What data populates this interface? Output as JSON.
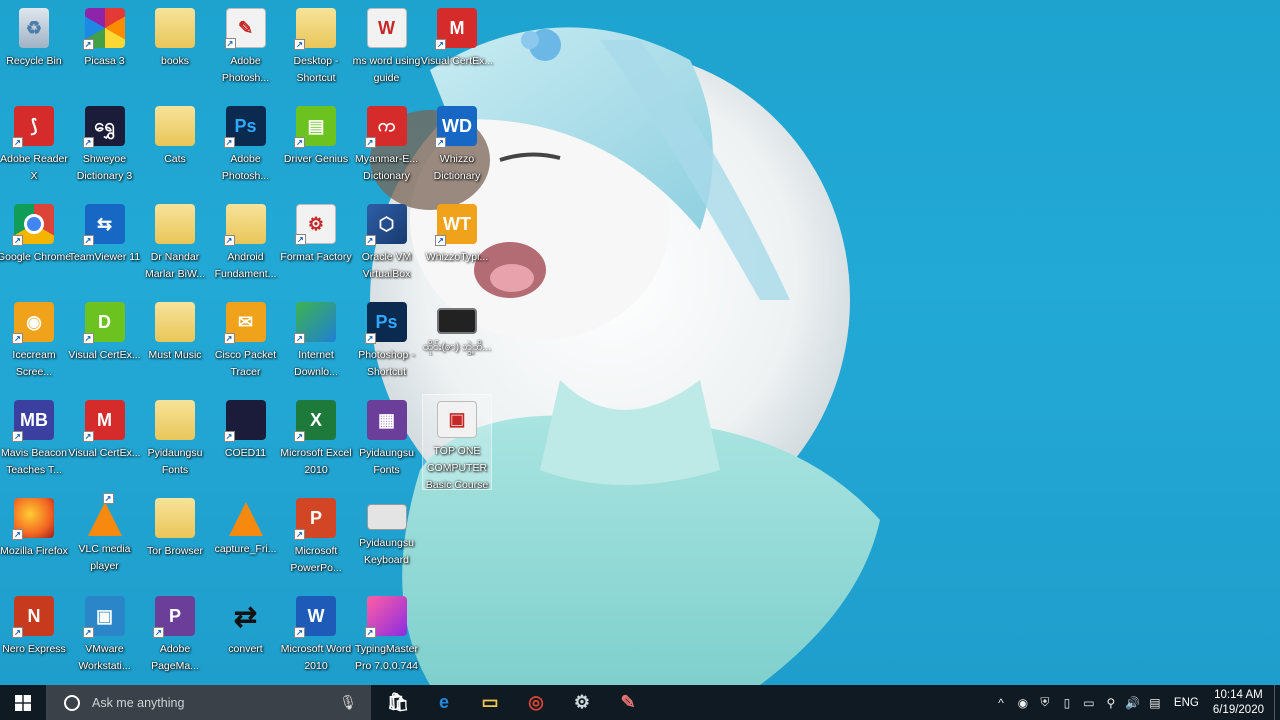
{
  "desktop": {
    "icons": [
      {
        "label": "Recycle Bin",
        "icon": "recycle-bin-icon",
        "glyph": "♻",
        "style": "g-bin",
        "col": 0,
        "row": 0,
        "shortcut": false
      },
      {
        "label": "Adobe Reader X",
        "icon": "adobe-reader-icon",
        "glyph": "⟆",
        "style": "g-red",
        "col": 0,
        "row": 1,
        "shortcut": true
      },
      {
        "label": "Google Chrome",
        "icon": "chrome-icon",
        "glyph": "",
        "style": "g-chrome",
        "col": 0,
        "row": 2,
        "shortcut": true
      },
      {
        "label": "Icecream Scree...",
        "icon": "icecream-recorder-icon",
        "glyph": "◉",
        "style": "g-orange",
        "col": 0,
        "row": 3,
        "shortcut": true
      },
      {
        "label": "Mavis Beacon Teaches T...",
        "icon": "mavis-beacon-icon",
        "glyph": "MB",
        "style": "g-purple",
        "col": 0,
        "row": 4,
        "shortcut": true
      },
      {
        "label": "Mozilla Firefox",
        "icon": "firefox-icon",
        "glyph": "",
        "style": "g-ff",
        "col": 0,
        "row": 5,
        "shortcut": true
      },
      {
        "label": "Nero Express",
        "icon": "nero-express-icon",
        "glyph": "N",
        "style": "g-nero",
        "col": 0,
        "row": 6,
        "shortcut": true
      },
      {
        "label": "Picasa 3",
        "icon": "picasa-icon",
        "glyph": "",
        "style": "g-picasa",
        "col": 1,
        "row": 0,
        "shortcut": true
      },
      {
        "label": "Shweyoe Dictionary 3",
        "icon": "shweyoe-dictionary-icon",
        "glyph": "ရွှေ",
        "style": "g-dark",
        "col": 1,
        "row": 1,
        "shortcut": true
      },
      {
        "label": "TeamViewer 11",
        "icon": "teamviewer-icon",
        "glyph": "⇆",
        "style": "g-blue",
        "col": 1,
        "row": 2,
        "shortcut": true
      },
      {
        "label": "Visual CertEx...",
        "icon": "visual-certexam-designer-icon",
        "glyph": "D",
        "style": "g-green",
        "col": 1,
        "row": 3,
        "shortcut": true
      },
      {
        "label": "Visual CertEx...",
        "icon": "visual-certexam-manager-icon",
        "glyph": "M",
        "style": "g-red",
        "col": 1,
        "row": 4,
        "shortcut": true
      },
      {
        "label": "VLC media player",
        "icon": "vlc-icon",
        "glyph": "",
        "style": "g-vlc",
        "col": 1,
        "row": 5,
        "shortcut": true
      },
      {
        "label": "VMware Workstati...",
        "icon": "vmware-icon",
        "glyph": "▣",
        "style": "g-vm",
        "col": 1,
        "row": 6,
        "shortcut": true
      },
      {
        "label": "books",
        "icon": "folder-icon",
        "glyph": "",
        "style": "g-folder",
        "col": 2,
        "row": 0,
        "shortcut": false
      },
      {
        "label": "Cats",
        "icon": "folder-icon",
        "glyph": "",
        "style": "g-folder",
        "col": 2,
        "row": 1,
        "shortcut": false
      },
      {
        "label": "Dr Nandar Marlar BiW...",
        "icon": "folder-icon",
        "glyph": "",
        "style": "g-folder",
        "col": 2,
        "row": 2,
        "shortcut": false
      },
      {
        "label": "Must Music",
        "icon": "folder-icon",
        "glyph": "",
        "style": "g-folder",
        "col": 2,
        "row": 3,
        "shortcut": false
      },
      {
        "label": "Pyidaungsu Fonts",
        "icon": "folder-icon",
        "glyph": "",
        "style": "g-folder",
        "col": 2,
        "row": 4,
        "shortcut": false
      },
      {
        "label": "Tor Browser",
        "icon": "folder-icon",
        "glyph": "",
        "style": "g-folder",
        "col": 2,
        "row": 5,
        "shortcut": false
      },
      {
        "label": "Adobe PageMa...",
        "icon": "adobe-pagemaker-icon",
        "glyph": "P",
        "style": "g-pm",
        "col": 2,
        "row": 6,
        "shortcut": true
      },
      {
        "label": "Adobe Photosh...",
        "icon": "photoshop-feather-icon",
        "glyph": "✎",
        "style": "g-white",
        "col": 3,
        "row": 0,
        "shortcut": true
      },
      {
        "label": "Adobe Photosh...",
        "icon": "photoshop-icon",
        "glyph": "Ps",
        "style": "g-ps",
        "col": 3,
        "row": 1,
        "shortcut": true
      },
      {
        "label": "Android Fundament...",
        "icon": "folder-icon",
        "glyph": "",
        "style": "g-folder",
        "col": 3,
        "row": 2,
        "shortcut": true
      },
      {
        "label": "Cisco Packet Tracer",
        "icon": "cisco-packet-tracer-icon",
        "glyph": "✉",
        "style": "g-orange",
        "col": 3,
        "row": 3,
        "shortcut": true
      },
      {
        "label": "COED11",
        "icon": "coed11-icon",
        "glyph": "",
        "style": "g-dark",
        "col": 3,
        "row": 4,
        "shortcut": true
      },
      {
        "label": "capture_Fri...",
        "icon": "vlc-icon",
        "glyph": "",
        "style": "g-vlc",
        "col": 3,
        "row": 5,
        "shortcut": false
      },
      {
        "label": "convert",
        "icon": "convert-arrows-icon",
        "glyph": "⇄",
        "style": "g-convert",
        "col": 3,
        "row": 6,
        "shortcut": false
      },
      {
        "label": "Desktop - Shortcut",
        "icon": "desktop-folder-icon",
        "glyph": "",
        "style": "g-folder",
        "col": 4,
        "row": 0,
        "shortcut": true
      },
      {
        "label": "Driver Genius",
        "icon": "driver-genius-icon",
        "glyph": "▤",
        "style": "g-green",
        "col": 4,
        "row": 1,
        "shortcut": true
      },
      {
        "label": "Format Factory",
        "icon": "format-factory-icon",
        "glyph": "⚙",
        "style": "g-white",
        "col": 4,
        "row": 2,
        "shortcut": true
      },
      {
        "label": "Internet Downlo...",
        "icon": "internet-download-manager-icon",
        "glyph": "",
        "style": "g-ie",
        "col": 4,
        "row": 3,
        "shortcut": true
      },
      {
        "label": "Microsoft Excel 2010",
        "icon": "excel-icon",
        "glyph": "X",
        "style": "g-excel",
        "col": 4,
        "row": 4,
        "shortcut": true
      },
      {
        "label": "Microsoft PowerPo...",
        "icon": "powerpoint-icon",
        "glyph": "P",
        "style": "g-ppt",
        "col": 4,
        "row": 5,
        "shortcut": true
      },
      {
        "label": "Microsoft Word 2010",
        "icon": "word-icon",
        "glyph": "W",
        "style": "g-word",
        "col": 4,
        "row": 6,
        "shortcut": true
      },
      {
        "label": "ms word using guide",
        "icon": "word-document-icon",
        "glyph": "W",
        "style": "g-white",
        "col": 5,
        "row": 0,
        "shortcut": false
      },
      {
        "label": "Myanmar-E... Dictionary",
        "icon": "myanmar-dictionary-icon",
        "glyph": "က",
        "style": "g-red",
        "col": 5,
        "row": 1,
        "shortcut": true
      },
      {
        "label": "Oracle VM VirtualBox",
        "icon": "virtualbox-icon",
        "glyph": "⬡",
        "style": "g-vbox",
        "col": 5,
        "row": 2,
        "shortcut": true
      },
      {
        "label": "Photoshop - Shortcut",
        "icon": "photoshop-icon",
        "glyph": "Ps",
        "style": "g-ps",
        "col": 5,
        "row": 3,
        "shortcut": true
      },
      {
        "label": "Pyidaungsu Fonts",
        "icon": "winrar-icon",
        "glyph": "▦",
        "style": "g-pm",
        "col": 5,
        "row": 4,
        "shortcut": false
      },
      {
        "label": "Pyidaungsu Keyboard",
        "icon": "keyboard-image-icon",
        "glyph": "",
        "style": "g-kbd",
        "col": 5,
        "row": 5,
        "shortcut": false
      },
      {
        "label": "TypingMaster Pro 7.0.0.744",
        "icon": "typingmaster-icon",
        "glyph": "",
        "style": "g-typing",
        "col": 5,
        "row": 6,
        "shortcut": true
      },
      {
        "label": "Visual CertEx...",
        "icon": "visual-certexam-manager-icon",
        "glyph": "M",
        "style": "g-red",
        "col": 6,
        "row": 0,
        "shortcut": true
      },
      {
        "label": "Whizzo Dictionary",
        "icon": "whizzo-dictionary-icon",
        "glyph": "WD",
        "style": "g-blue",
        "col": 6,
        "row": 1,
        "shortcut": true
      },
      {
        "label": "WhizzoTypi...",
        "icon": "whizzo-typing-icon",
        "glyph": "WT",
        "style": "g-orange",
        "col": 6,
        "row": 2,
        "shortcut": true
      },
      {
        "label": "ထိုင်း(ဇာ) ဘွဲ့ထိ...",
        "icon": "video-file-icon",
        "glyph": "",
        "style": "g-film",
        "col": 6,
        "row": 3,
        "shortcut": false
      },
      {
        "label": "TOP ONE COMPUTER Basic Course",
        "icon": "pdf-document-icon",
        "glyph": "▣",
        "style": "g-white",
        "col": 6,
        "row": 4,
        "shortcut": false,
        "selected": true
      }
    ]
  },
  "taskbar": {
    "search_placeholder": "Ask me anything",
    "pinned": [
      {
        "name": "store-icon",
        "color": "#ffffff"
      },
      {
        "name": "edge-icon",
        "color": "#1e8ae0"
      },
      {
        "name": "file-explorer-icon",
        "color": "#f2c94c"
      },
      {
        "name": "chrome-icon",
        "color": "#db4437"
      },
      {
        "name": "format-factory-icon",
        "color": "#cfd8dc"
      },
      {
        "name": "paint-icon",
        "color": "#e57373"
      }
    ],
    "tray": {
      "icons": [
        "chevron-up-icon",
        "icecream-tray-icon",
        "shield-icon",
        "usb-icon",
        "battery-icon",
        "network-icon",
        "volume-icon",
        "notifications-icon"
      ],
      "language": "ENG",
      "time": "10:14 AM",
      "date": "6/19/2020"
    }
  }
}
